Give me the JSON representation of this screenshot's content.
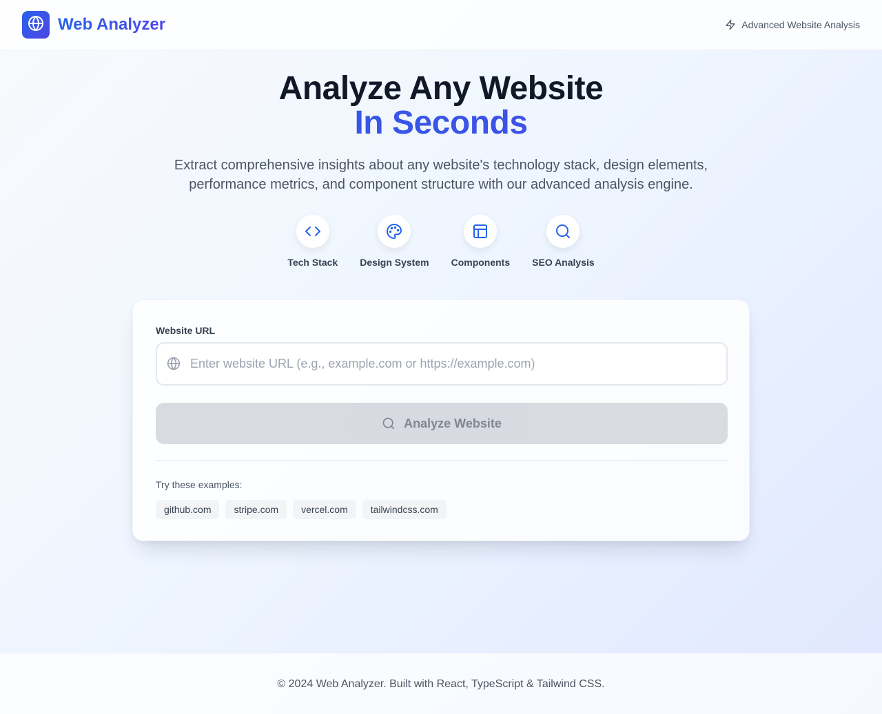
{
  "header": {
    "app_name": "Web Analyzer",
    "tagline": "Advanced Website Analysis",
    "logo_icon": "globe-icon",
    "tagline_icon": "zap-icon"
  },
  "hero": {
    "title_line1": "Analyze Any Website",
    "title_line2": "In Seconds",
    "subtitle": "Extract comprehensive insights about any website's technology stack, design elements, performance metrics, and component structure with our advanced analysis engine."
  },
  "features": [
    {
      "label": "Tech Stack",
      "icon": "code-icon"
    },
    {
      "label": "Design System",
      "icon": "palette-icon"
    },
    {
      "label": "Components",
      "icon": "layout-icon"
    },
    {
      "label": "SEO Analysis",
      "icon": "search-icon"
    }
  ],
  "form": {
    "url_label": "Website URL",
    "url_value": "",
    "url_placeholder": "Enter website URL (e.g., example.com or https://example.com)",
    "analyze_label": "Analyze Website",
    "analyze_disabled": true,
    "examples_label": "Try these examples:",
    "examples": [
      "github.com",
      "stripe.com",
      "vercel.com",
      "tailwindcss.com"
    ]
  },
  "footer": {
    "text": "© 2024 Web Analyzer. Built with React, TypeScript & Tailwind CSS."
  },
  "colors": {
    "accent": "#2563eb",
    "accent_secondary": "#4f46e5",
    "disabled_button": "#d1d5db"
  }
}
